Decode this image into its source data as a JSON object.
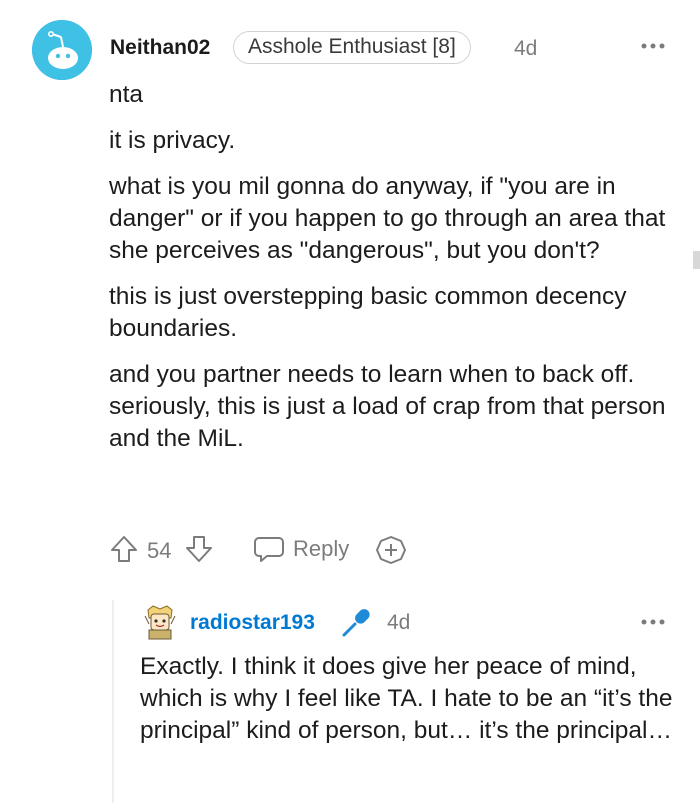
{
  "comment": {
    "username": "Neithan02",
    "flair": "Asshole Enthusiast [8]",
    "age": "4d",
    "more_icon": "more-options-icon",
    "paragraphs": [
      "nta",
      "it is privacy.",
      "what is you mil gonna do anyway, if \"you are in danger\" or if you happen to go through an area that she perceives as \"dangerous\", but you don't?",
      "this is just overstepping basic common decency boundaries.",
      "and you partner needs to learn when to back off. seriously, this is just a load of crap from that person and the MiL."
    ],
    "votes": "54",
    "reply_label": "Reply",
    "icons": [
      "upvote-icon",
      "downvote-icon",
      "reply-icon",
      "award-icon"
    ]
  },
  "reply": {
    "username": "radiostar193",
    "age": "4d",
    "user_color": "#0079d3",
    "paragraphs": [
      "Exactly. I think it does give her peace of mind, which is why I feel like TA. I hate to be an “it’s the principal” kind of person, but… it’s the principal…"
    ]
  }
}
